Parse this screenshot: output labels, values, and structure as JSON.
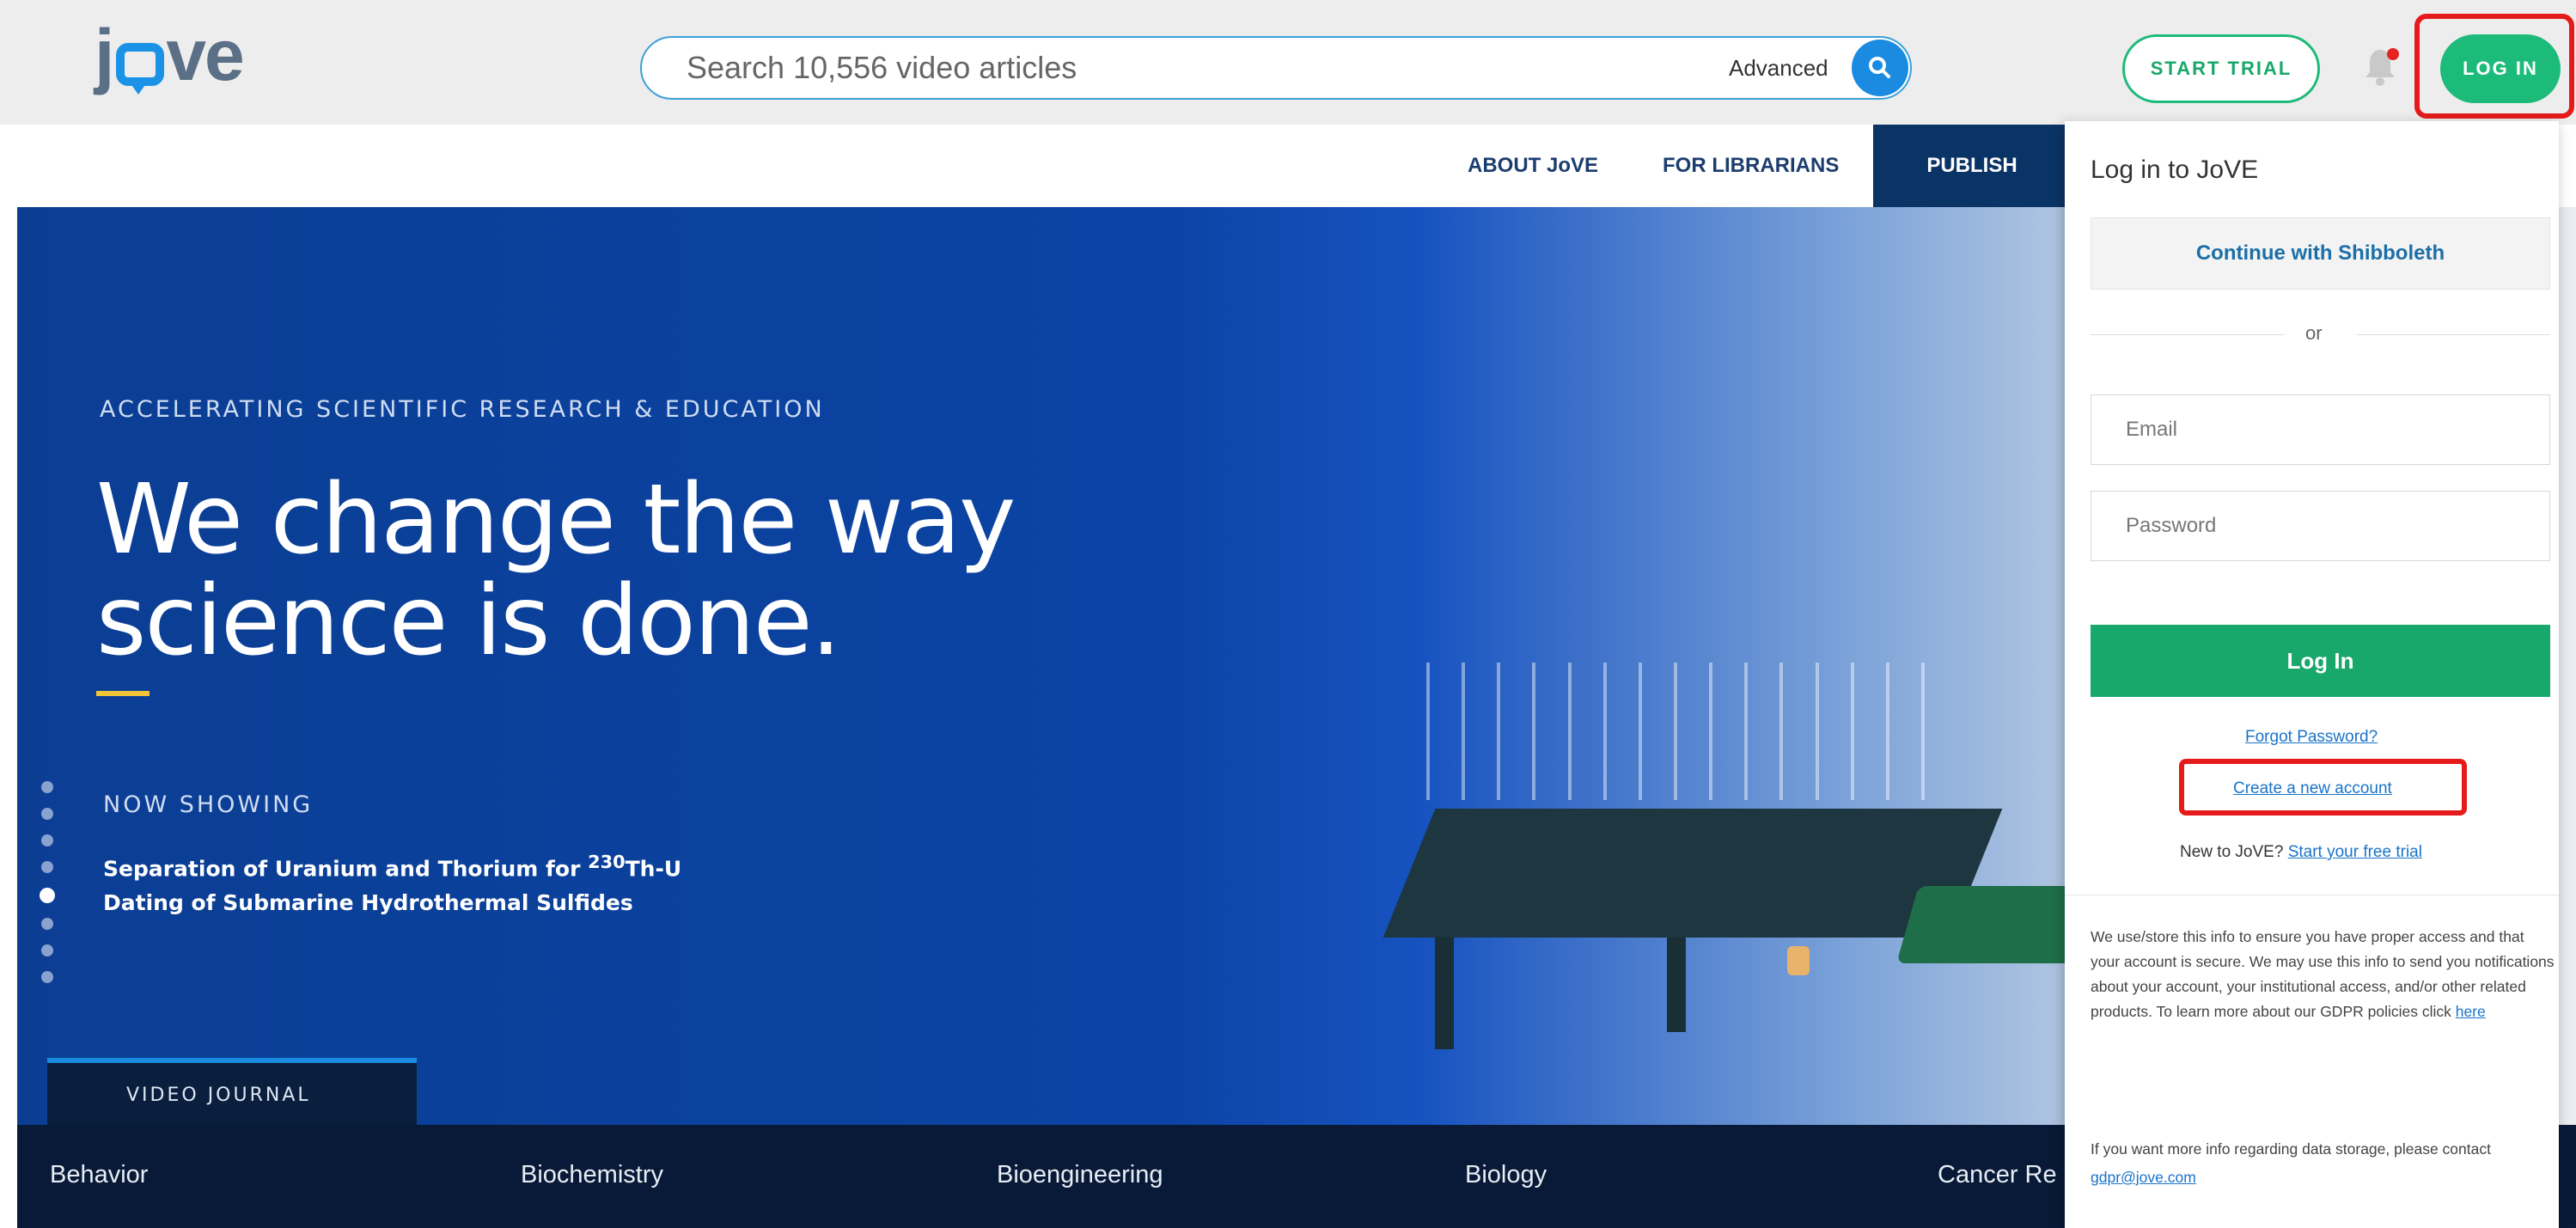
{
  "header": {
    "logo_text_pre": "j",
    "logo_text_post": "ve",
    "search_placeholder": "Search 10,556 video articles",
    "search_advanced": "Advanced",
    "start_trial_label": "START TRIAL",
    "login_label": "LOG IN"
  },
  "nav": {
    "items": [
      "ABOUT JoVE",
      "FOR LIBRARIANS",
      "PUBLISH"
    ]
  },
  "hero": {
    "kicker": "ACCELERATING SCIENTIFIC RESEARCH & EDUCATION",
    "title_line1": "We change the way",
    "title_line2": "science is done.",
    "now_showing_label": "NOW SHOWING",
    "showing_title_pre": "Separation of Uranium and Thorium for ",
    "showing_title_sup": "230",
    "showing_title_mid": "Th-U",
    "showing_title_line2": "Dating of Submarine Hydrothermal Sulfides",
    "video_journal_tab": "VIDEO JOURNAL",
    "carousel_dots_total": 8,
    "carousel_dot_active_index": 5
  },
  "categories": [
    "Behavior",
    "Biochemistry",
    "Bioengineering",
    "Biology",
    "Cancer Re"
  ],
  "login_panel": {
    "title": "Log in to JoVE",
    "shibboleth_label": "Continue with Shibboleth",
    "or_text": "or",
    "email_placeholder": "Email",
    "password_placeholder": "Password",
    "submit_label": "Log In",
    "forgot_label": "Forgot Password?",
    "create_account_label": "Create a new account",
    "new_to_text": "New to JoVE?",
    "start_trial_link": "Start your free trial",
    "gdpr_text": "We use/store this info to ensure you have proper access and that your account is secure. We may use this info to send you notifications about your account, your institutional access, and/or other related products. To learn more about our GDPR policies click",
    "gdpr_link": "here",
    "storage_text": "If you want more info regarding data storage, please contact",
    "storage_email": "gdpr@jove.com"
  },
  "colors": {
    "accent_green": "#1dbb7a",
    "brand_blue": "#1a8be0",
    "highlight_red": "#e51a1a",
    "nav_navy": "#0b3466"
  },
  "icons": [
    "search-icon",
    "bell-icon"
  ]
}
